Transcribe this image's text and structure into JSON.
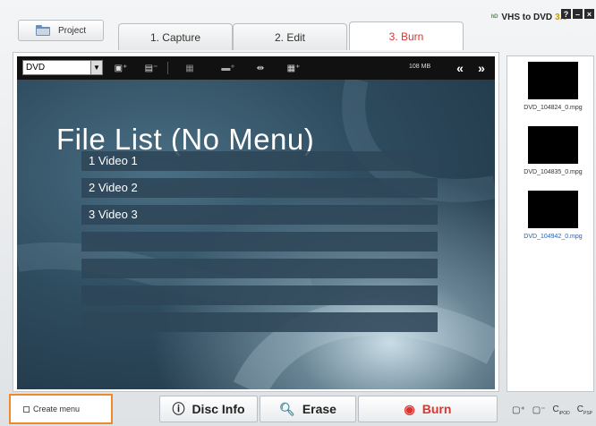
{
  "project_label": "Project",
  "tabs": [
    {
      "label": "1. Capture"
    },
    {
      "label": "2. Edit"
    },
    {
      "label": "3. Burn"
    }
  ],
  "brand": {
    "name": "VHS to DVD",
    "version": "3.0"
  },
  "toolbar": {
    "disc_type": "DVD",
    "size": "108 MB"
  },
  "preview": {
    "title": "File List (No Menu)",
    "rows": [
      "1  Video 1",
      "2  Video 2",
      "3  Video 3",
      "",
      "",
      "",
      ""
    ]
  },
  "files": [
    {
      "name": "DVD_104824_0.mpg",
      "selected": false
    },
    {
      "name": "DVD_104835_0.mpg",
      "selected": false
    },
    {
      "name": "DVD_104942_0.mpg",
      "selected": true
    }
  ],
  "bottom": {
    "create_menu": "Create menu",
    "disc_info": "Disc Info",
    "erase": "Erase",
    "burn": "Burn"
  },
  "mini_icons": [
    "add-file-icon",
    "remove-file-icon",
    "ipod-export-icon",
    "psp-export-icon"
  ],
  "colors": {
    "accent": "#e0322c",
    "highlight": "#ef8a2a",
    "selected_text": "#2260c0"
  }
}
